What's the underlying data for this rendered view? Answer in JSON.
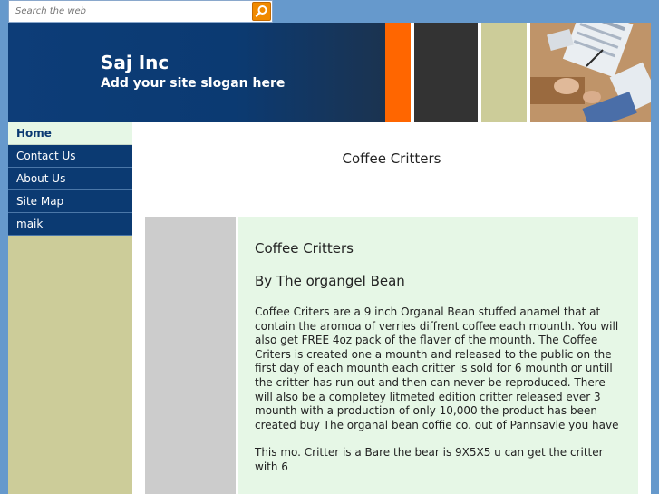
{
  "search": {
    "placeholder": "Search the web",
    "button_icon": "search-icon"
  },
  "header": {
    "title": "Saj Inc",
    "slogan": "Add your site slogan here",
    "colors": {
      "band": "#0b3a72",
      "orange": "#ff6600",
      "dark": "#333333",
      "khaki": "#cccc99"
    }
  },
  "nav": {
    "items": [
      {
        "label": "Home",
        "active": true
      },
      {
        "label": "Contact Us",
        "active": false
      },
      {
        "label": "About Us",
        "active": false
      },
      {
        "label": "Site Map",
        "active": false
      },
      {
        "label": "maik",
        "active": false
      }
    ]
  },
  "main": {
    "page_title": "Coffee Critters",
    "panel": {
      "heading1": "Coffee Critters",
      "heading2": "By The organgel Bean",
      "paragraph1": "Coffee Criters are a 9 inch Organal Bean stuffed anamel that at contain the aromoa of verries diffrent coffee each mounth. You will also get FREE 4oz pack of the flaver of the mounth. The Coffee Criters  is created one a mounth and released to the public on the first day of each mounth each critter is sold for 6 mounth  or untill the critter has run out and then can never be reproduced. There will also be a completey litmeted edition critter released ever 3 mounth with a production of only 10,000  the product has been created buy The organal bean coffie co. out of Pannsavle you have",
      "paragraph2": "This mo. Critter is a Bare the bear is 9X5X5 u can get the critter with 6"
    }
  }
}
